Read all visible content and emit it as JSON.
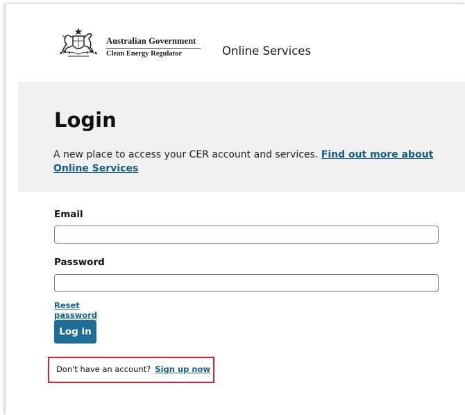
{
  "header": {
    "gov_line1": "Australian Government",
    "gov_line2": "Clean Energy Regulator",
    "site_title": "Online Services"
  },
  "hero": {
    "title": "Login",
    "intro_text": "A new place to access your CER account and services.",
    "intro_link": "Find out more about Online Services"
  },
  "form": {
    "email_label": "Email",
    "email_value": "",
    "password_label": "Password",
    "password_value": "",
    "reset_link": "Reset password",
    "login_button": "Log in"
  },
  "signup": {
    "prompt": "Don't have an account?",
    "link": "Sign up now"
  },
  "colors": {
    "link": "#135e8a",
    "button": "#1f6e97",
    "hero_bg": "#f0f0f0",
    "highlight": "#d8242b"
  },
  "icons": {
    "crest": "australian-coat-of-arms-icon"
  }
}
